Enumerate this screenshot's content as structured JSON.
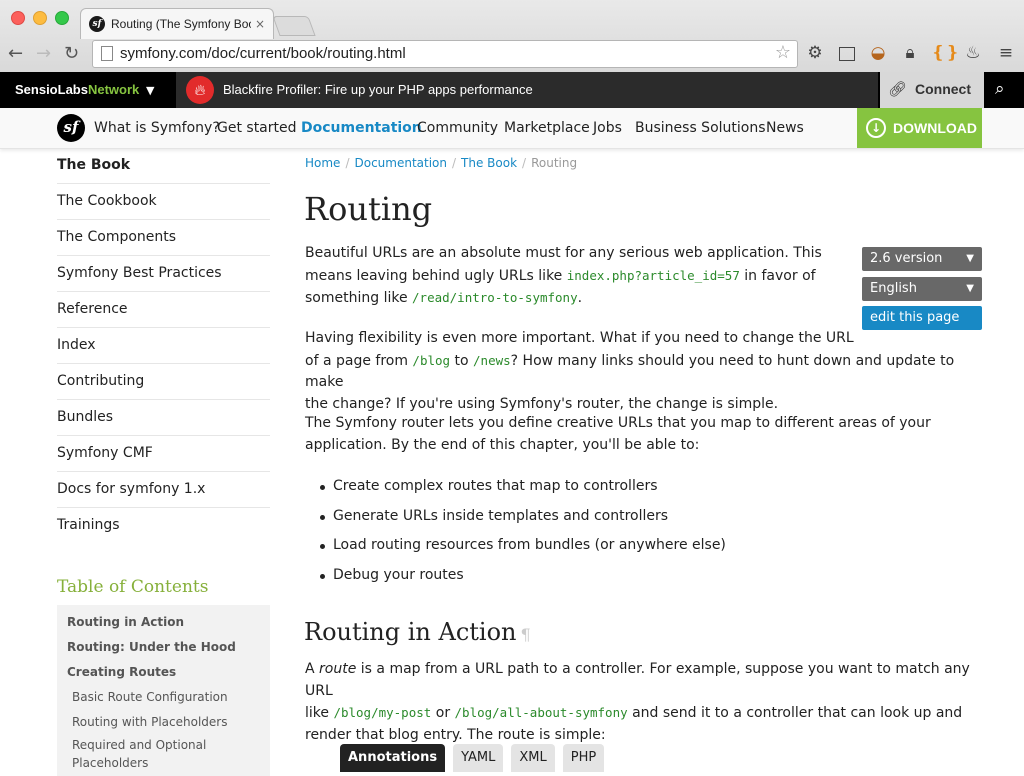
{
  "browser": {
    "tab_title": "Routing (The Symfony Boo",
    "tab_close": "×",
    "url": "symfony.com/doc/current/book/routing.html",
    "icons": [
      "back-icon",
      "forward-icon",
      "reload-icon",
      "page-icon",
      "star-icon",
      "gear-icon",
      "screen-icon",
      "basket-icon",
      "lock-icon",
      "extension-icon",
      "flame-icon",
      "menu-icon"
    ]
  },
  "sensio": {
    "logo_main": "SensioLabs",
    "logo_net": "Network",
    "caret": "▼",
    "blackfire_text": "Blackfire Profiler: Fire up your PHP apps performance",
    "connect_label": "Connect"
  },
  "nav": {
    "logo": "sf",
    "items": [
      "What is Symfony?",
      "Get started",
      "Documentation",
      "Community",
      "Marketplace",
      "Jobs",
      "Business Solutions",
      "News"
    ],
    "active": "Documentation",
    "download_label": "DOWNLOAD"
  },
  "sidebar": {
    "items": [
      "The Book",
      "The Cookbook",
      "The Components",
      "Symfony Best Practices",
      "Reference",
      "Index",
      "Contributing",
      "Bundles",
      "Symfony CMF",
      "Docs for symfony 1.x",
      "Trainings"
    ],
    "toc_title": "Table of Contents",
    "toc": [
      "Routing in Action",
      "Routing: Under the Hood",
      "Creating Routes"
    ],
    "toc_sub": [
      "Basic Route Configuration",
      "Routing with Placeholders",
      "Required and Optional Placeholders"
    ]
  },
  "breadcrumb": [
    "Home",
    "Documentation",
    "The Book",
    "Routing"
  ],
  "content": {
    "title": "Routing",
    "p1_a": "Beautiful URLs are an absolute must for any serious web application. This",
    "p1_b": "means leaving behind ugly URLs like ",
    "p1_code1": "index.php?article_id=57",
    "p1_c": " in favor of",
    "p1_d": "something like ",
    "p1_code2": "/read/intro-to-symfony",
    "p1_e": ".",
    "p2_a": "Having flexibility is even more important. What if you need to change the URL",
    "p2_b": "of a page from ",
    "p2_code1": "/blog",
    "p2_c": " to ",
    "p2_code2": "/news",
    "p2_d": "? How many links should you need to hunt down and update to make",
    "p2_e": "the change? If you're using Symfony's router, the change is simple.",
    "p3_a": "The Symfony router lets you define creative URLs that you map to different areas of your",
    "p3_b": "application. By the end of this chapter, you'll be able to:",
    "bullets": [
      "Create complex routes that map to controllers",
      "Generate URLs inside templates and controllers",
      "Load routing resources from bundles (or anywhere else)",
      "Debug your routes"
    ],
    "h2": "Routing in Action",
    "pilcrow": "¶",
    "p4_a1": "A ",
    "p4_em": "route",
    "p4_a2": " is a map from a URL path to a controller. For example, suppose you want to match any URL",
    "p4_b1": "like ",
    "p4_code1": "/blog/my-post",
    "p4_b2": " or ",
    "p4_code2": "/blog/all-about-symfony",
    "p4_b3": " and send it to a controller that can look up and",
    "p4_c": "render that blog entry. The route is simple:",
    "version_select": "2.6 version",
    "language_select": "English",
    "edit_label": "edit this page",
    "code_tabs": [
      "Annotations",
      "YAML",
      "XML",
      "PHP"
    ]
  }
}
